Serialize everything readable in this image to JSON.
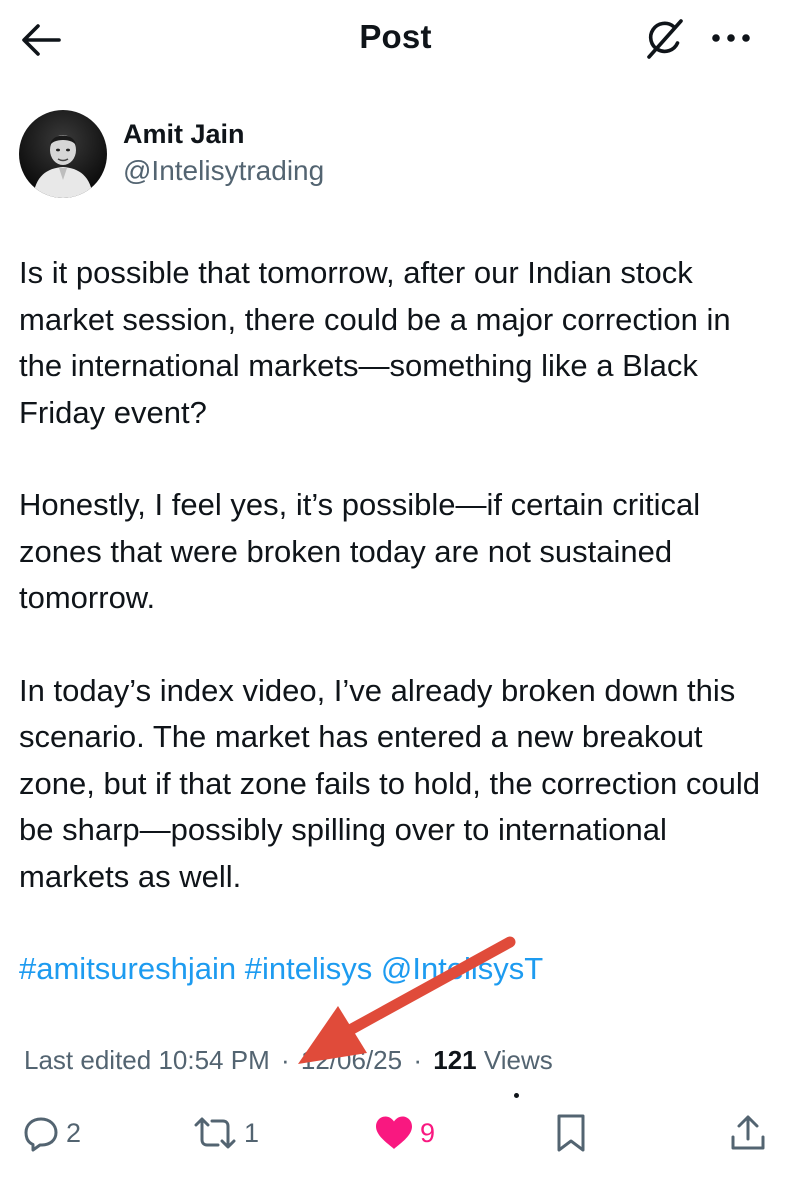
{
  "header": {
    "title": "Post",
    "back_icon": "arrow-left-icon",
    "grok_icon": "grok-icon",
    "more_icon": "more-horizontal-icon"
  },
  "author": {
    "name": "Amit Jain",
    "handle": "@Intelisytrading",
    "avatar_icon": "profile-photo"
  },
  "post": {
    "paragraph_1": "Is it possible that tomorrow, after our Indian stock market session, there could be a major correction in the international markets—something like a Black Friday event?",
    "paragraph_2": "Honestly, I feel yes, it’s possible—if certain critical zones that were broken today are not sustained tomorrow.",
    "paragraph_3": "In today’s index video, I’ve already broken down this scenario. The market has entered a new breakout zone, but if that zone fails to hold, the correction could be sharp—possibly spilling over to international markets as well.",
    "hashtag_1": "#amitsureshjain",
    "hashtag_2": "#intelisys",
    "mention": "@IntelisysT"
  },
  "meta": {
    "edited_label": "Last edited",
    "time": "10:54 PM",
    "separator": "·",
    "date": "12/06/25",
    "views_count": "121",
    "views_label": "Views"
  },
  "actions": {
    "replies": "2",
    "reposts": "1",
    "likes": "9",
    "reply_icon": "reply-icon",
    "repost_icon": "repost-icon",
    "like_icon": "heart-filled-icon",
    "bookmark_icon": "bookmark-icon",
    "share_icon": "share-icon"
  },
  "colors": {
    "text": "#0f1419",
    "secondary": "#536471",
    "link": "#1d9bf0",
    "like": "#f91880",
    "annotation": "#e04b3a"
  }
}
